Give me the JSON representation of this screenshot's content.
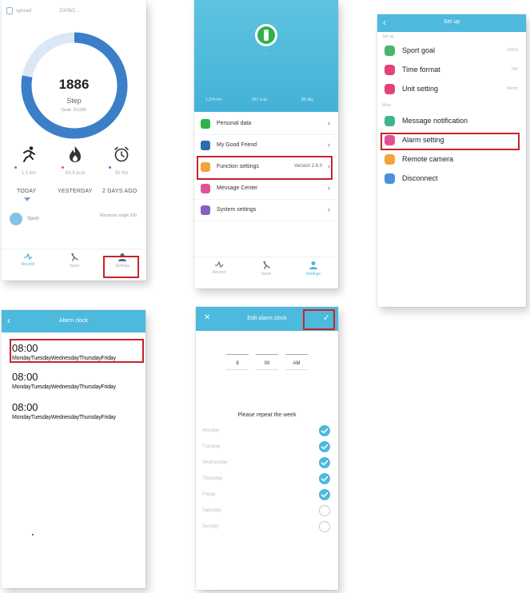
{
  "screen1": {
    "status_left": "synced",
    "status_right": "20/09/2...",
    "steps": "1886",
    "steps_label": "Step",
    "goal_text": "Goal: 10,000",
    "stats": [
      {
        "icon": "running-icon",
        "value": "1.1 km"
      },
      {
        "icon": "flame-icon",
        "value": "83.8 kcal"
      },
      {
        "icon": "alarm-clock-icon",
        "value": "2h 0m"
      }
    ],
    "days": [
      "TODAY",
      "YESTERDAY",
      "2 DAYS AGO"
    ],
    "sport_label": "Sport",
    "sport_right": "Maximum single 200",
    "nav": [
      "Record",
      "Sport",
      "Settings"
    ],
    "ring_color": "#3a7fc8",
    "ring_fill": 0.78
  },
  "screen2": {
    "avatar_label": "...",
    "stats": [
      "1,234 km",
      "567 kcal",
      "89 day"
    ],
    "menu": [
      {
        "label": "Personal data",
        "icon_color": "#2eb24a"
      },
      {
        "label": "My Good Friend",
        "icon_color": "#2b6cb0"
      },
      {
        "label": "Function settings",
        "right": "Version 2.6.0",
        "icon_color": "#f0a43c"
      },
      {
        "label": "Message Center",
        "icon_color": "#e05294"
      },
      {
        "label": "System settings",
        "icon_color": "#8a5cc8"
      }
    ],
    "nav": [
      "Record",
      "Sport",
      "Settings"
    ]
  },
  "screen3": {
    "title": "Set up",
    "group1": "Set up",
    "items1": [
      {
        "label": "Sport goal",
        "right": "10000",
        "icon_color": "#4ab56a"
      },
      {
        "label": "Time format",
        "right": "24h",
        "icon_color": "#e0437a"
      },
      {
        "label": "Unit setting",
        "right": "Metric",
        "icon_color": "#e0437a"
      }
    ],
    "group2": "More",
    "items2": [
      {
        "label": "Message notification",
        "icon_color": "#3fb58e"
      },
      {
        "label": "Alarm setting",
        "icon_color": "#e05294"
      },
      {
        "label": "Remote camera",
        "icon_color": "#f0a43c"
      },
      {
        "label": "Disconnect",
        "icon_color": "#4a90d9"
      }
    ]
  },
  "screen4": {
    "title": "Alarm clock",
    "alarms": [
      {
        "time": "08:00",
        "days": "MondayTuesdayWednesdayThursdayFriday"
      },
      {
        "time": "08:00",
        "days": "MondayTuesdayWednesdayThursdayFriday"
      },
      {
        "time": "08:00",
        "days": "MondayTuesdayWednesdayThursdayFriday"
      }
    ]
  },
  "screen5": {
    "title": "Edit alarm clock",
    "hour": "8",
    "minute": "00",
    "ampm": "AM",
    "repeat_label": "Please repeat the week",
    "days": [
      {
        "label": "Monday",
        "checked": true
      },
      {
        "label": "Tuesday",
        "checked": true
      },
      {
        "label": "Wednesday",
        "checked": true
      },
      {
        "label": "Thursday",
        "checked": true
      },
      {
        "label": "Friday",
        "checked": true
      },
      {
        "label": "Saturday",
        "checked": false
      },
      {
        "label": "Sunday",
        "checked": false
      }
    ],
    "accent": "#4cb9dd"
  }
}
